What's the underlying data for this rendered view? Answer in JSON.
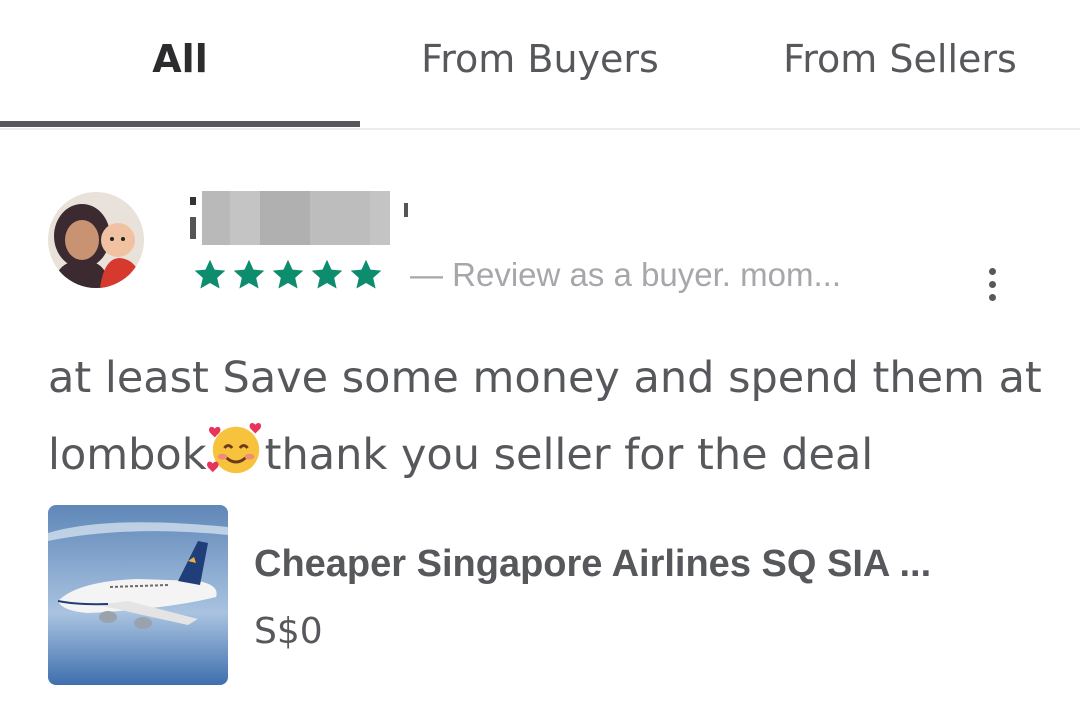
{
  "tabs": [
    {
      "label": "All",
      "active": true
    },
    {
      "label": "From Buyers",
      "active": false
    },
    {
      "label": "From Sellers",
      "active": false
    }
  ],
  "review": {
    "rating": 5,
    "rating_max": 5,
    "meta": "— Review as a buyer.   mom...",
    "text_part1": "at least Save some money and spend them at lombok",
    "emoji": "smiling-face-with-hearts",
    "text_part2": "thank you seller for the deal"
  },
  "listing": {
    "title": "Cheaper Singapore Airlines SQ SIA ...",
    "price": "S$0"
  },
  "colors": {
    "star": "#0e8c6e",
    "text": "#57585b",
    "muted": "#a6a7aa"
  }
}
